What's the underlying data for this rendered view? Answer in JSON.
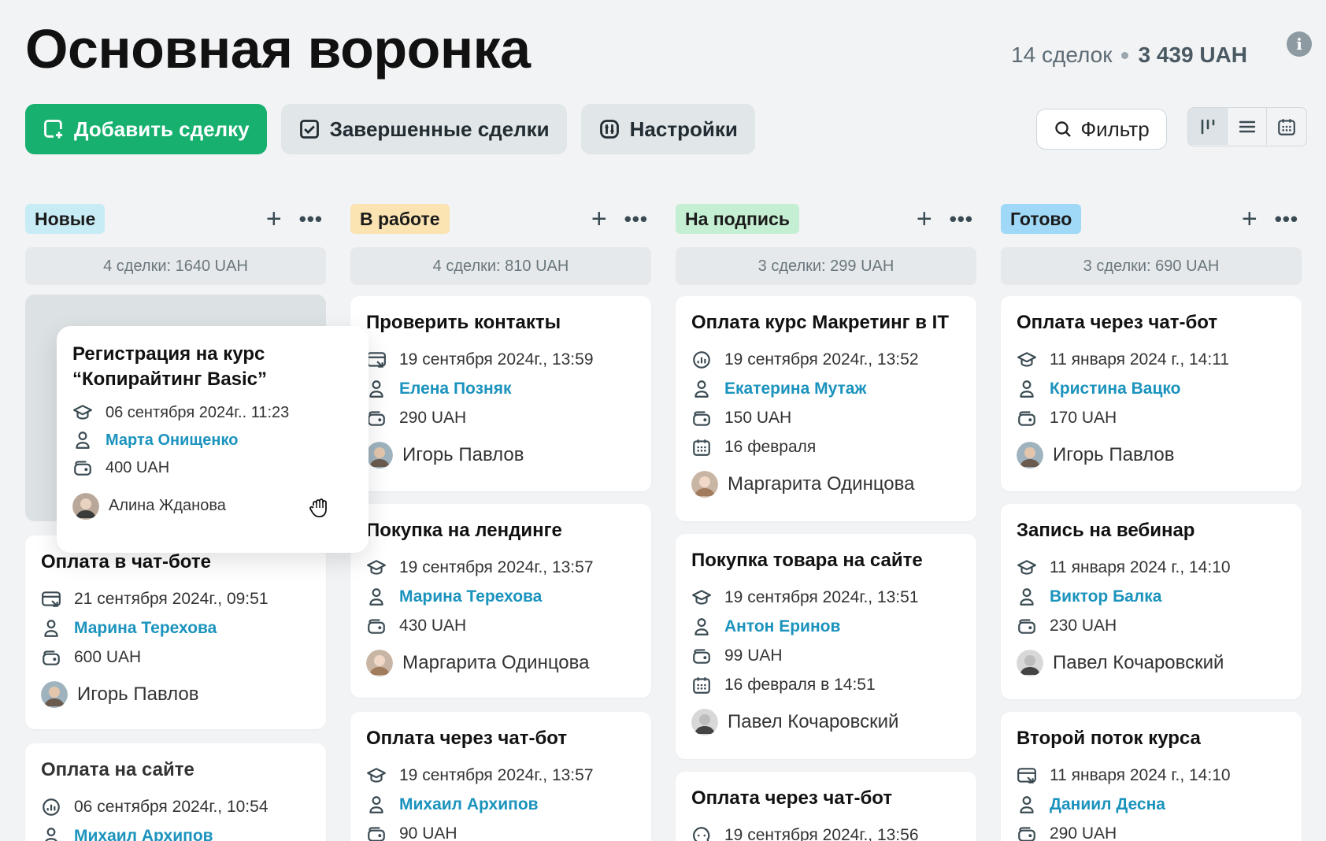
{
  "header": {
    "title": "Основная воронка",
    "deals_count": "14 сделок",
    "total": "3 439 UAH"
  },
  "toolbar": {
    "add_deal": "Добавить сделку",
    "completed": "Завершенные сделки",
    "settings": "Настройки",
    "filter": "Фильтр"
  },
  "colors": {
    "primary": "#17b06f",
    "link": "#1b93bd",
    "badge_new": "#c8ecf6",
    "badge_work": "#fbe3b2",
    "badge_sign": "#c5efd2",
    "badge_done": "#9fd9f7"
  },
  "columns": [
    {
      "name": "Новые",
      "stats": "4 сделки: 1640 UAH"
    },
    {
      "name": "В работе",
      "stats": "4 сделки: 810 UAH"
    },
    {
      "name": "На подпись",
      "stats": "3 сделки: 299 UAH"
    },
    {
      "name": "Готово",
      "stats": "3 сделки: 690 UAH"
    }
  ],
  "dragged": {
    "title1": "Регистрация на курс",
    "title2": "“Копирайтинг Basic”",
    "date": "06 сентября 2024г.. 11:23",
    "client": "Марта Онищенко",
    "amount": "400 UAH",
    "owner": "Алина Жданова"
  },
  "cards": {
    "c1_1": {
      "title": "Оплата в чат-боте",
      "date": "21 сентября 2024г., 09:51",
      "client": "Марина Терехова",
      "amount": "600 UAH",
      "owner": "Игорь Павлов"
    },
    "c1_2": {
      "title": "Оплата на сайте",
      "date": "06 сентября 2024г., 10:54",
      "client": "Михаил Архипов"
    },
    "c2_1": {
      "title": "Проверить контакты",
      "date": "19 сентября 2024г., 13:59",
      "client": "Елена Позняк",
      "amount": "290 UAH",
      "owner": "Игорь Павлов"
    },
    "c2_2": {
      "title": "Покупка на лендинге",
      "date": "19 сентября 2024г., 13:57",
      "client": "Марина Терехова",
      "amount": "430 UAH",
      "owner": "Маргарита Одинцова"
    },
    "c2_3": {
      "title": "Оплата через чат-бот",
      "date": "19 сентября 2024г., 13:57",
      "client": "Михаил Архипов",
      "amount": "90 UAH"
    },
    "c3_1": {
      "title": "Оплата курс Макретинг в IT",
      "date": "19 сентября 2024г., 13:52",
      "client": "Екатерина Мутаж",
      "amount": "150 UAH",
      "due": "16 февраля",
      "owner": "Маргарита Одинцова"
    },
    "c3_2": {
      "title": "Покупка товара на сайте",
      "date": "19 сентября 2024г., 13:51",
      "client": "Антон Еринов",
      "amount": "99 UAH",
      "due": "16 февраля в 14:51",
      "owner": "Павел Кочаровский"
    },
    "c3_3": {
      "title": "Оплата через чат-бот",
      "date": "19 сентября 2024г., 13:56"
    },
    "c4_1": {
      "title": "Оплата через чат-бот",
      "date": "11 января 2024 г., 14:11",
      "client": "Кристина Вацко",
      "amount": "170 UAH",
      "owner": "Игорь Павлов"
    },
    "c4_2": {
      "title": "Запись на вебинар",
      "date": "11 января 2024 г., 14:10",
      "client": "Виктор Балка",
      "amount": "230 UAH",
      "owner": "Павел Кочаровский"
    },
    "c4_3": {
      "title": "Второй поток курса",
      "date": "11 января 2024 г., 14:10",
      "client": "Даниил Десна",
      "amount": "290 UAH"
    }
  }
}
